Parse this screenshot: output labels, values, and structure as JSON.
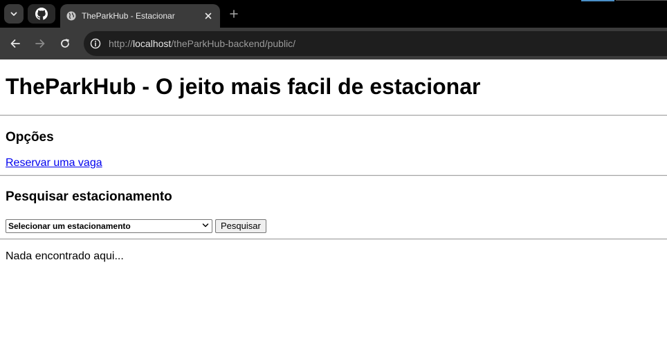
{
  "browser": {
    "tab_title": "TheParkHub - Estacionar",
    "url_scheme": "http://",
    "url_host": "localhost",
    "url_path": "/theParkHub-backend/public/"
  },
  "page": {
    "heading": "TheParkHub - O jeito mais facil de estacionar",
    "options_heading": "Opções",
    "reserve_link": "Reservar uma vaga",
    "search_heading": "Pesquisar estacionamento",
    "select_value": "Selecionar um estacionamento",
    "search_button": "Pesquisar",
    "empty_message": "Nada encontrado aqui..."
  },
  "icons": {
    "tab_search": "chevron-down-icon",
    "github": "github-icon",
    "favicon": "globe-icon",
    "close_tab": "close-icon",
    "new_tab": "plus-icon",
    "back": "arrow-left-icon",
    "forward": "arrow-right-icon",
    "reload": "reload-icon",
    "site_info": "info-icon"
  },
  "colors": {
    "link": "#0000ee",
    "chrome_bg": "#000000",
    "toolbar_bg": "#3b3b3b"
  }
}
